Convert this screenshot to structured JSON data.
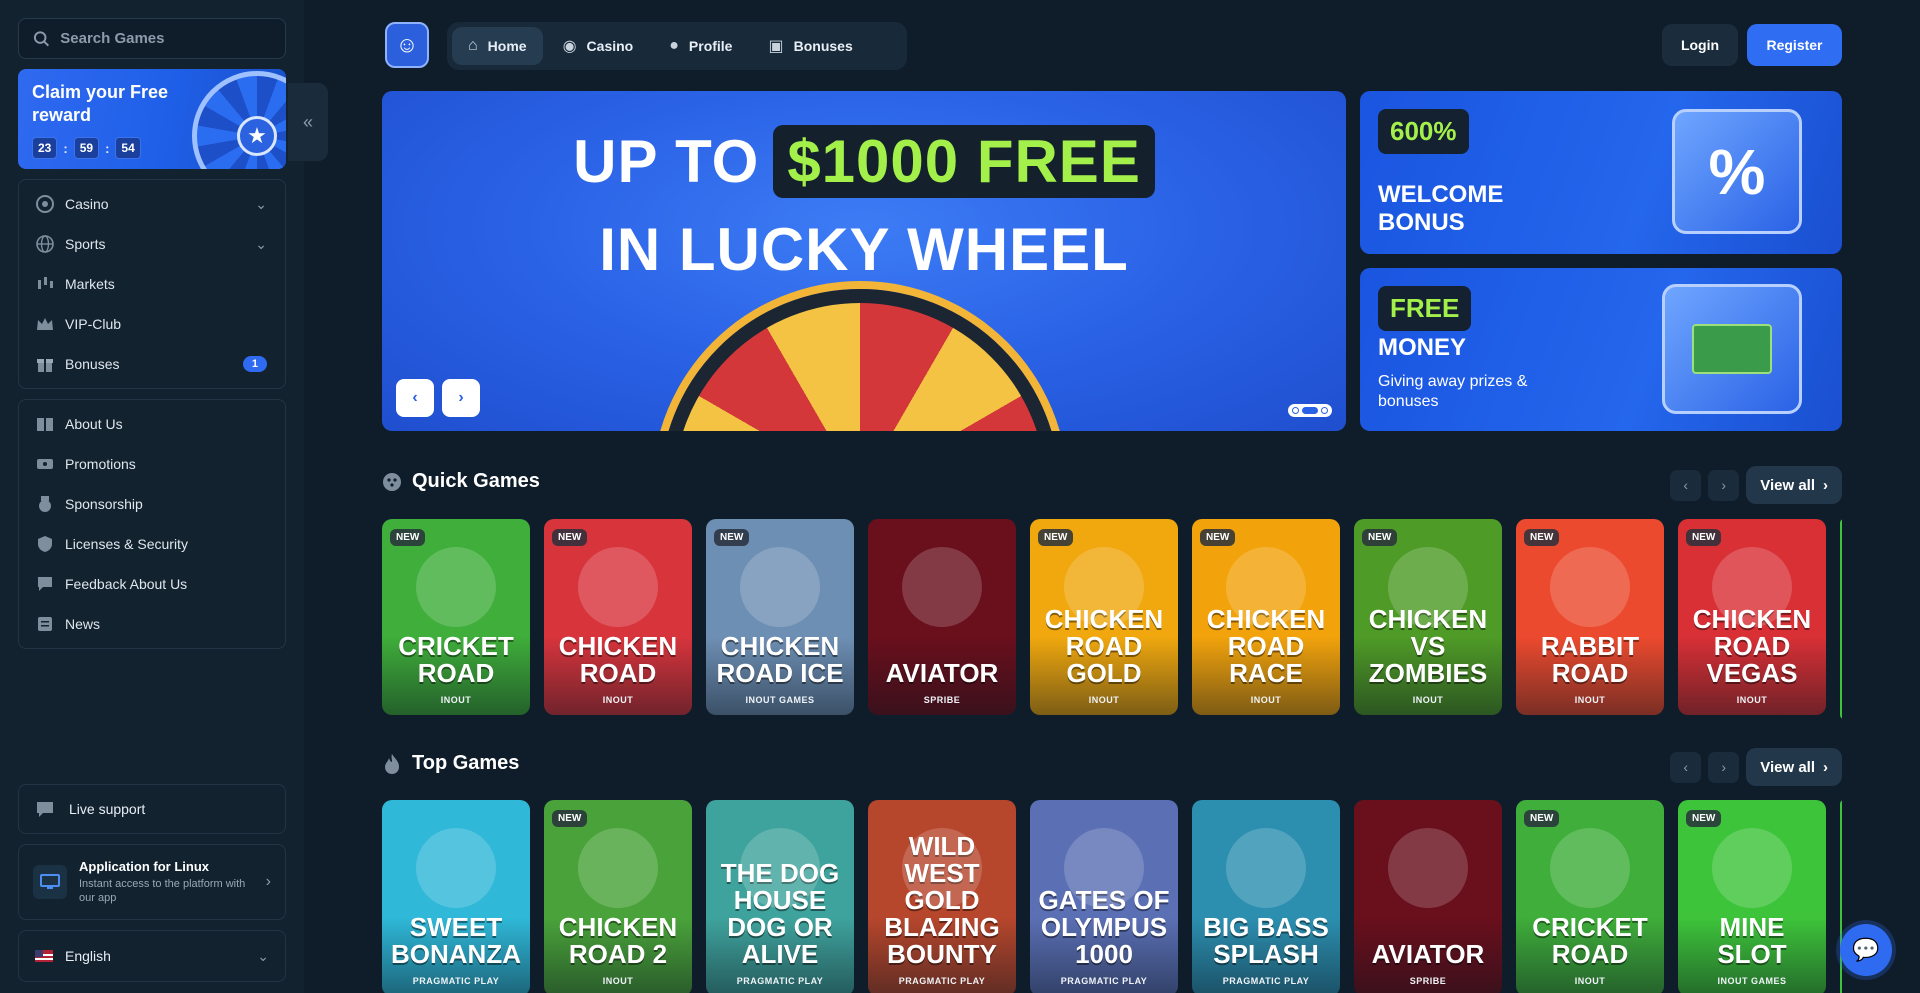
{
  "search": {
    "placeholder": "Search Games"
  },
  "reward": {
    "title": "Claim your Free reward",
    "timer": [
      "23",
      "59",
      "54"
    ]
  },
  "nav_primary": [
    {
      "label": "Casino",
      "icon": "casino-chip-icon",
      "has_chevron": true
    },
    {
      "label": "Sports",
      "icon": "globe-icon",
      "has_chevron": true
    },
    {
      "label": "Markets",
      "icon": "candlestick-icon"
    },
    {
      "label": "VIP-Club",
      "icon": "crown-icon"
    },
    {
      "label": "Bonuses",
      "icon": "gift-icon",
      "badge": "1"
    }
  ],
  "nav_secondary": [
    {
      "label": "About Us",
      "icon": "book-icon"
    },
    {
      "label": "Promotions",
      "icon": "ticket-icon"
    },
    {
      "label": "Sponsorship",
      "icon": "medal-icon"
    },
    {
      "label": "Licenses & Security",
      "icon": "shield-icon"
    },
    {
      "label": "Feedback About Us",
      "icon": "feedback-icon"
    },
    {
      "label": "News",
      "icon": "newspaper-icon"
    }
  ],
  "live_support": {
    "label": "Live support"
  },
  "app_promo": {
    "title": "Application for Linux",
    "subtitle": "Instant access to the platform with our app"
  },
  "language": {
    "label": "English"
  },
  "header": {
    "tabs": [
      {
        "label": "Home",
        "icon": "home-icon",
        "active": true
      },
      {
        "label": "Casino",
        "icon": "casino-chip-icon"
      },
      {
        "label": "Profile",
        "icon": "user-icon"
      },
      {
        "label": "Bonuses",
        "icon": "gift-icon"
      }
    ],
    "login": "Login",
    "register": "Register"
  },
  "hero": {
    "line1_a": "UP TO",
    "line1_b": "$1000 FREE",
    "line2": "IN LUCKY WHEEL",
    "slides": 3,
    "active_slide": 2
  },
  "promo1": {
    "pill": "600%",
    "title_l1": "WELCOME",
    "title_l2": "BONUS"
  },
  "promo2": {
    "pill": "FREE",
    "title": "MONEY",
    "subtitle": "Giving away prizes & bonuses"
  },
  "quick_games": {
    "title": "Quick Games",
    "view_all": "View all",
    "games": [
      {
        "name": "Cricket Road",
        "provider": "INOUT",
        "new": true,
        "bg": "#3fae3a"
      },
      {
        "name": "Chicken Road",
        "provider": "INOUT",
        "new": true,
        "bg": "#d8343c"
      },
      {
        "name": "Chicken Road Ice",
        "provider": "INOUT GAMES",
        "new": true,
        "bg": "#6e8fb4"
      },
      {
        "name": "Aviator",
        "provider": "SPRIBE",
        "new": false,
        "bg": "#6a0f1c"
      },
      {
        "name": "Chicken Road Gold",
        "provider": "INOUT",
        "new": true,
        "bg": "#f0a80e"
      },
      {
        "name": "Chicken Road Race",
        "provider": "INOUT",
        "new": true,
        "bg": "#f2a30c"
      },
      {
        "name": "Chicken vs Zombies",
        "provider": "INOUT",
        "new": true,
        "bg": "#4f9b27"
      },
      {
        "name": "Rabbit Road",
        "provider": "INOUT",
        "new": true,
        "bg": "#ec4a2e"
      },
      {
        "name": "Chicken Road Vegas",
        "provider": "INOUT",
        "new": true,
        "bg": "#d83035"
      }
    ]
  },
  "top_games": {
    "title": "Top Games",
    "view_all": "View all",
    "games": [
      {
        "name": "Sweet Bonanza",
        "provider": "PRAGMATIC PLAY",
        "new": false,
        "bg": "#2fb8d8"
      },
      {
        "name": "Chicken Road 2",
        "provider": "INOUT",
        "new": true,
        "bg": "#4aa33a"
      },
      {
        "name": "The Dog House Dog or Alive",
        "provider": "PRAGMATIC PLAY",
        "new": false,
        "bg": "#3fa39d"
      },
      {
        "name": "Wild West Gold Blazing Bounty",
        "provider": "PRAGMATIC PLAY",
        "new": false,
        "bg": "#b6462c"
      },
      {
        "name": "Gates of Olympus 1000",
        "provider": "PRAGMATIC PLAY",
        "new": false,
        "bg": "#5b6fb4"
      },
      {
        "name": "Big Bass Splash",
        "provider": "PRAGMATIC PLAY",
        "new": false,
        "bg": "#2c8fb0"
      },
      {
        "name": "Aviator",
        "provider": "SPRIBE",
        "new": false,
        "bg": "#6a0f1c"
      },
      {
        "name": "Cricket Road",
        "provider": "INOUT",
        "new": true,
        "bg": "#3fae3a"
      },
      {
        "name": "Mine Slot",
        "provider": "INOUT GAMES",
        "new": true,
        "bg": "#3ec43a"
      }
    ]
  },
  "colors": {
    "accent": "#2e6bf0",
    "highlight_green": "#a3f04a",
    "bg": "#0f1d2b"
  }
}
